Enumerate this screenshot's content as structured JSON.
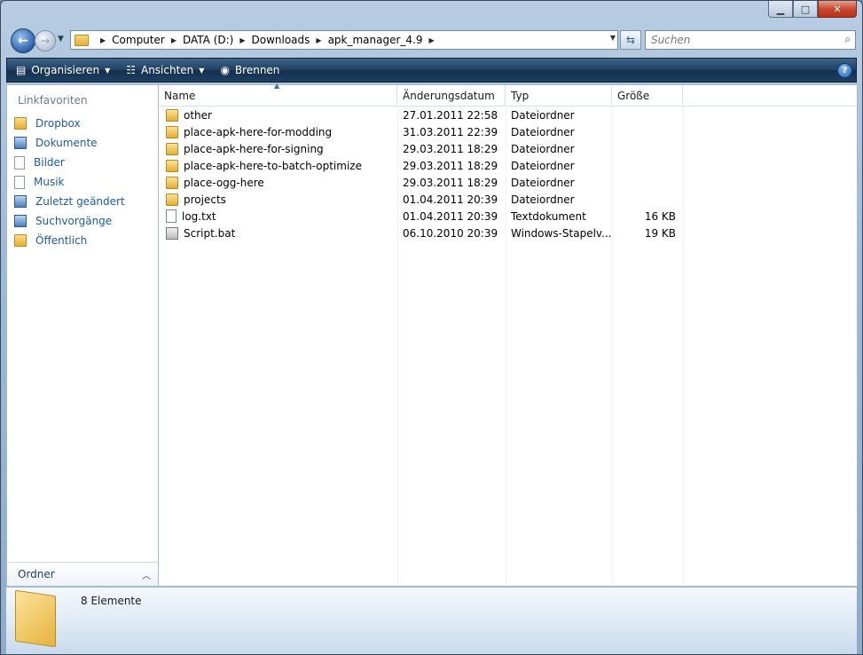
{
  "window": {
    "caption": {
      "minimize": "▁",
      "maximize": "□",
      "close": "✕"
    }
  },
  "nav": {
    "breadcrumbs": [
      "Computer",
      "DATA (D:)",
      "Downloads",
      "apk_manager_4.9"
    ],
    "search_placeholder": "Suchen"
  },
  "toolbar": {
    "organize_label": "Organisieren",
    "views_label": "Ansichten",
    "burn_label": "Brennen",
    "help_label": "?"
  },
  "sidebar": {
    "heading": "Linkfavoriten",
    "items": [
      {
        "label": "Dropbox",
        "icon": "folder-icon"
      },
      {
        "label": "Dokumente",
        "icon": "documents-icon"
      },
      {
        "label": "Bilder",
        "icon": "pictures-icon"
      },
      {
        "label": "Musik",
        "icon": "music-icon"
      },
      {
        "label": "Zuletzt geändert",
        "icon": "recent-icon"
      },
      {
        "label": "Suchvorgänge",
        "icon": "searches-icon"
      },
      {
        "label": "Öffentlich",
        "icon": "folder-icon"
      }
    ],
    "folders_label": "Ordner"
  },
  "files": {
    "columns": [
      "Name",
      "Änderungsdatum",
      "Typ",
      "Größe"
    ],
    "rows": [
      {
        "name": "other",
        "date": "27.01.2011 22:58",
        "type": "Dateiordner",
        "size": "",
        "icon": "folder"
      },
      {
        "name": "place-apk-here-for-modding",
        "date": "31.03.2011 22:39",
        "type": "Dateiordner",
        "size": "",
        "icon": "folder"
      },
      {
        "name": "place-apk-here-for-signing",
        "date": "29.03.2011 18:29",
        "type": "Dateiordner",
        "size": "",
        "icon": "folder"
      },
      {
        "name": "place-apk-here-to-batch-optimize",
        "date": "29.03.2011 18:29",
        "type": "Dateiordner",
        "size": "",
        "icon": "folder"
      },
      {
        "name": "place-ogg-here",
        "date": "29.03.2011 18:29",
        "type": "Dateiordner",
        "size": "",
        "icon": "folder"
      },
      {
        "name": "projects",
        "date": "01.04.2011 20:39",
        "type": "Dateiordner",
        "size": "",
        "icon": "folder"
      },
      {
        "name": "log.txt",
        "date": "01.04.2011 20:39",
        "type": "Textdokument",
        "size": "16 KB",
        "icon": "text"
      },
      {
        "name": "Script.bat",
        "date": "06.10.2010 20:39",
        "type": "Windows-Stapelv...",
        "size": "19 KB",
        "icon": "bat"
      }
    ]
  },
  "details": {
    "count_label": "8 Elemente"
  }
}
